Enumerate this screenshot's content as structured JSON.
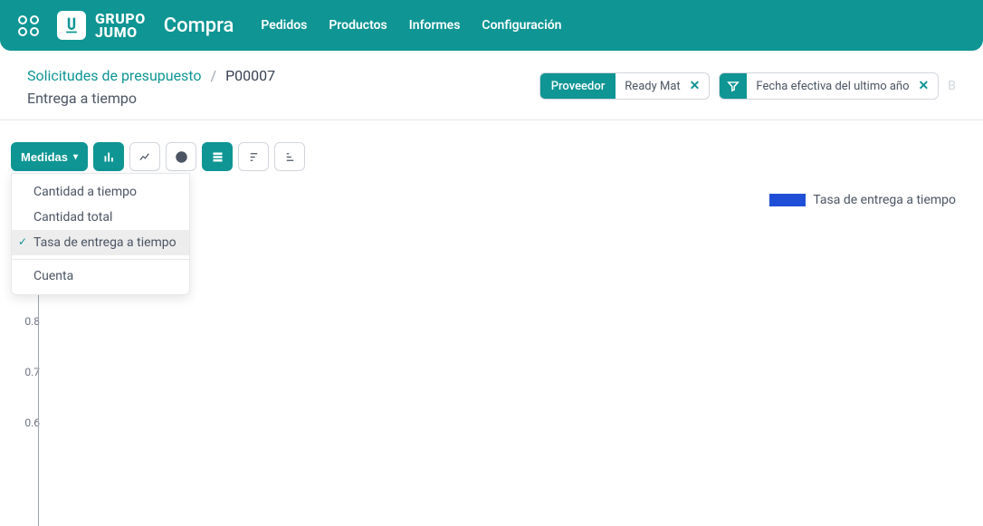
{
  "brand": {
    "name_line1": "GRUPO",
    "name_line2": "JUMO"
  },
  "app_title": "Compra",
  "nav": [
    {
      "label": "Pedidos"
    },
    {
      "label": "Productos"
    },
    {
      "label": "Informes"
    },
    {
      "label": "Configuración"
    }
  ],
  "breadcrumb": {
    "parent": "Solicitudes de presupuesto",
    "current": "P00007"
  },
  "page_title": "Entrega a tiempo",
  "filters": [
    {
      "tag": "Proveedor",
      "value": "Ready Mat"
    },
    {
      "tag_icon": "filter",
      "value": "Fecha efectiva del ultimo año"
    }
  ],
  "trailing": "B",
  "measures_button": "Medidas",
  "measures_dropdown": [
    {
      "label": "Cantidad a tiempo",
      "selected": false
    },
    {
      "label": "Cantidad total",
      "selected": false
    },
    {
      "label": "Tasa de entrega a tiempo",
      "selected": true
    },
    {
      "label": "Cuenta",
      "selected": false,
      "divider_before": true
    }
  ],
  "legend_label": "Tasa de entrega a tiempo",
  "chart_data": {
    "type": "bar",
    "title": "",
    "categories": [],
    "series": [
      {
        "name": "Tasa de entrega a tiempo",
        "values": []
      }
    ],
    "ylabel": "",
    "ylim": [
      0,
      1
    ],
    "yticks": [
      0.8,
      0.7,
      0.6
    ],
    "legend_position": "top-right"
  },
  "colors": {
    "primary": "#0e9594",
    "legend_series": "#1f4fd6"
  }
}
